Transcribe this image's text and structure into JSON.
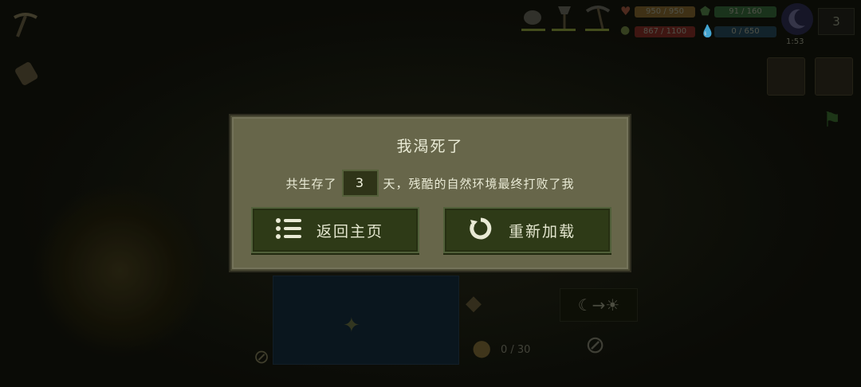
{
  "hud": {
    "health_text": "950 / 950",
    "shield_text": "91 / 160",
    "hunger_text": "867 / 1100",
    "water_text": "0 / 650",
    "clock_time": "1:53",
    "day_count": "3",
    "inventory_count": "0 / 30"
  },
  "dialog": {
    "title": "我渴死了",
    "message_prefix": "共生存了",
    "days": "3",
    "message_suffix": "天，残酷的自然环境最终打败了我",
    "home_button_label": "返回主页",
    "reload_button_label": "重新加载"
  },
  "colors": {
    "panel": "#67664a",
    "button": "#2e3a17",
    "text": "#e9ead5"
  },
  "icons": [
    "pickaxe-icon",
    "scroll-icon",
    "shovel-icon",
    "axe-icon",
    "pickaxe-tool-icon",
    "heart-icon",
    "shield-icon",
    "food-icon",
    "water-drop-icon",
    "moon-icon",
    "list-icon",
    "reload-icon",
    "day-night-icon",
    "no-entry-icon"
  ]
}
